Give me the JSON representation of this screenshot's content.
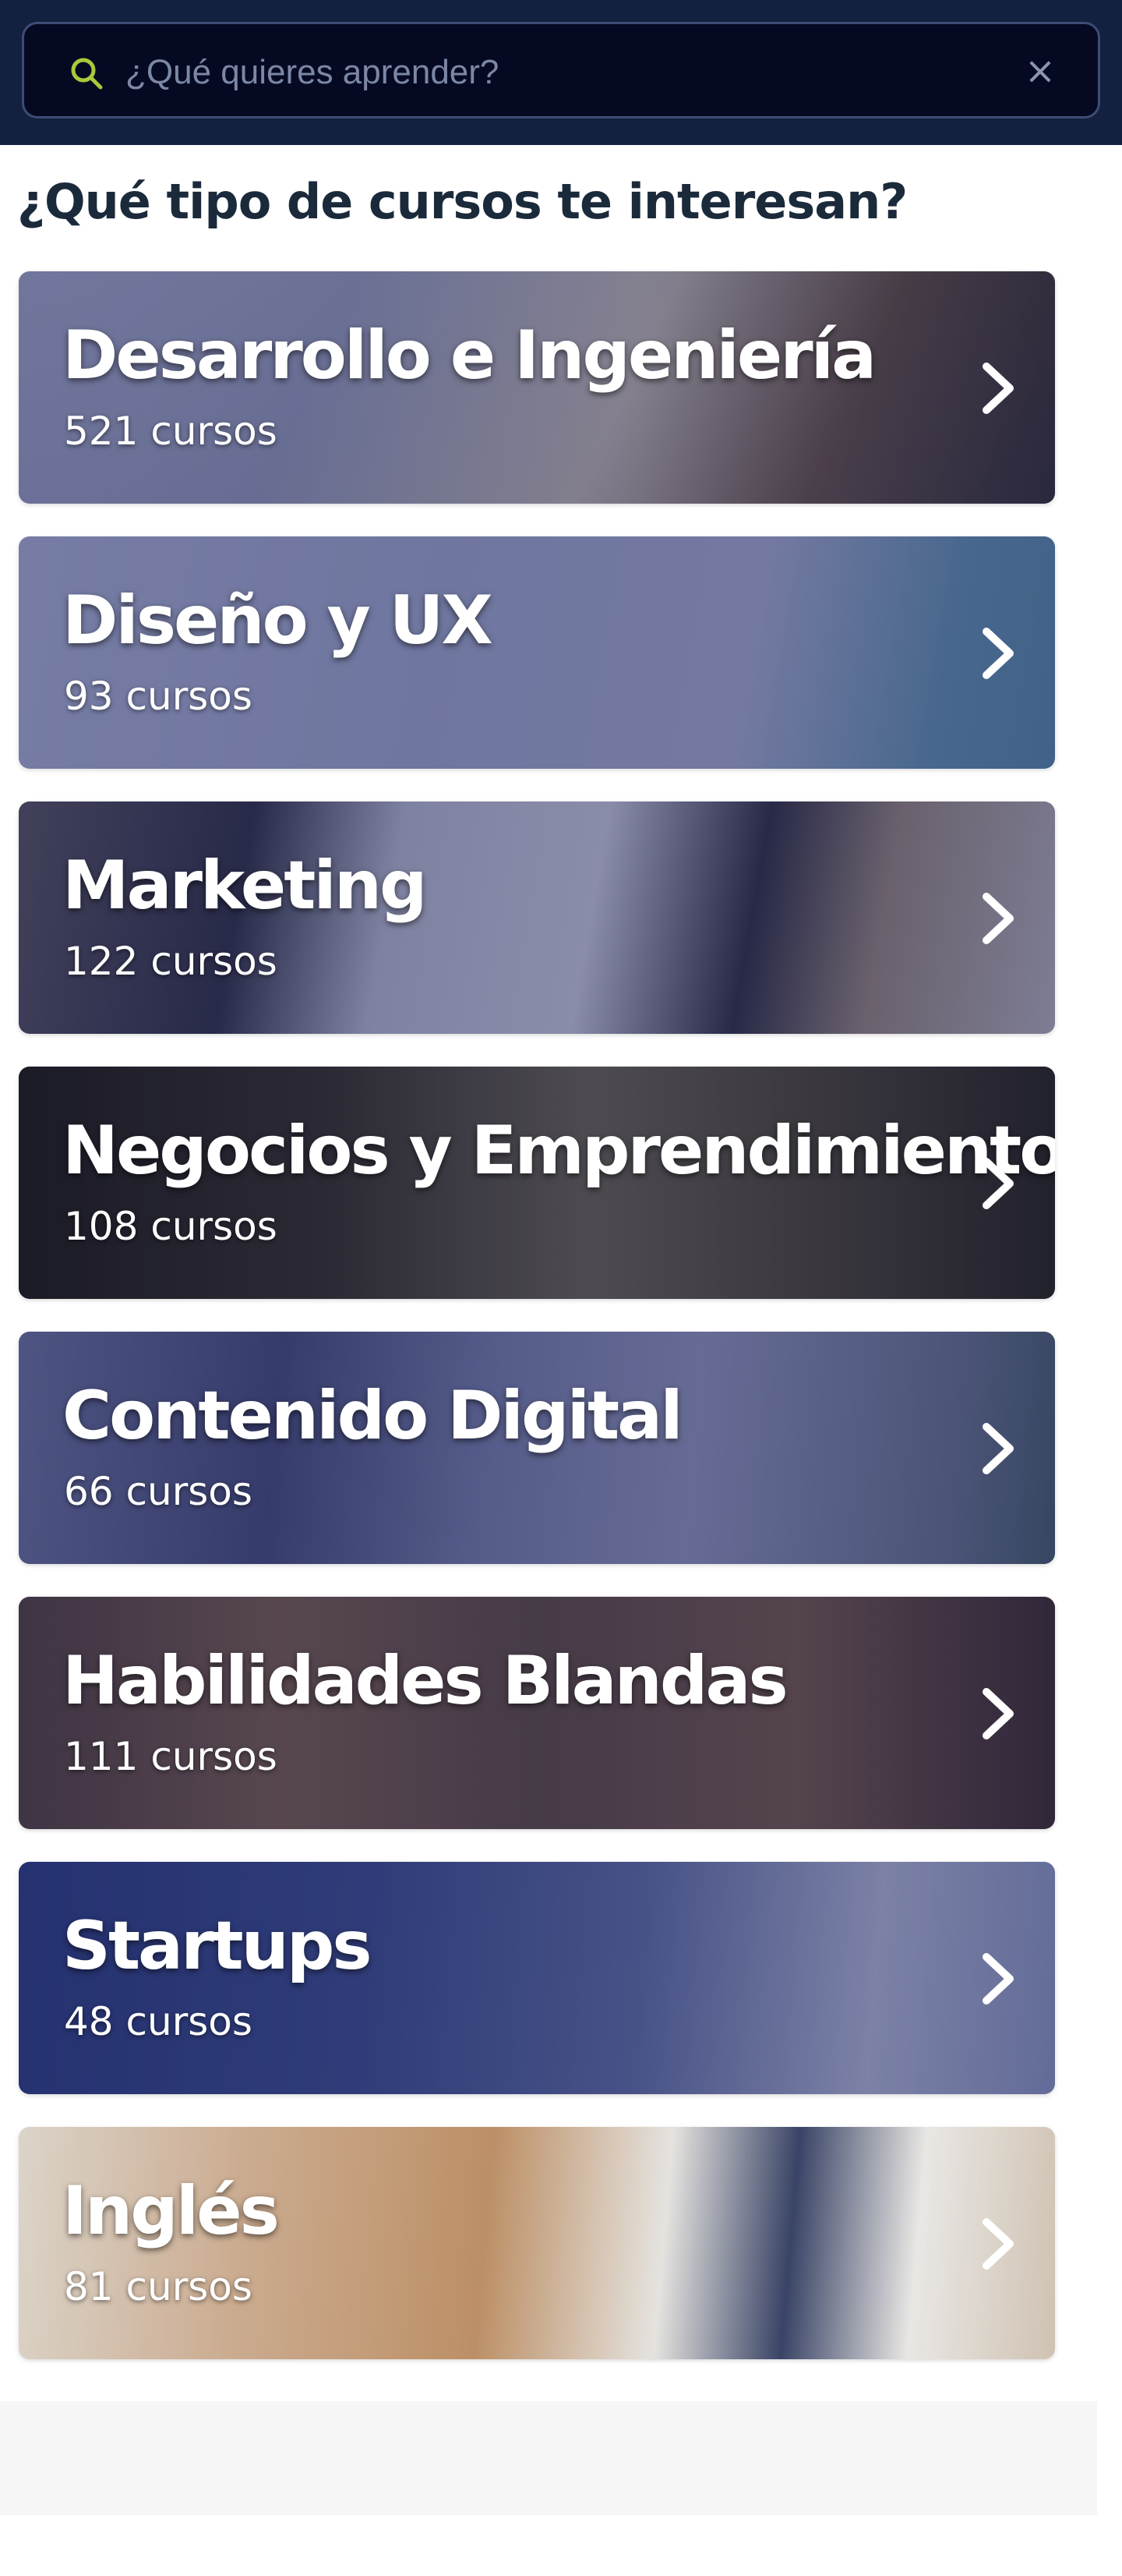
{
  "search": {
    "placeholder": "¿Qué quieres aprender?",
    "icon": "search-icon",
    "clear_icon": "×"
  },
  "page": {
    "title": "¿Qué tipo de cursos te interesan?"
  },
  "categories": [
    {
      "title": "Desarrollo e Ingeniería",
      "count": "521 cursos"
    },
    {
      "title": "Diseño y UX",
      "count": "93 cursos"
    },
    {
      "title": "Marketing",
      "count": "122 cursos"
    },
    {
      "title": "Negocios y Emprendimiento",
      "count": "108 cursos"
    },
    {
      "title": "Contenido Digital",
      "count": "66 cursos"
    },
    {
      "title": "Habilidades Blandas",
      "count": "111 cursos"
    },
    {
      "title": "Startups",
      "count": "48 cursos"
    },
    {
      "title": "Inglés",
      "count": "81 cursos"
    }
  ],
  "colors": {
    "header_background": "#13203f",
    "search_background": "#050a22",
    "search_icon": "#a8c93a",
    "title_text": "#1b2a3b"
  }
}
